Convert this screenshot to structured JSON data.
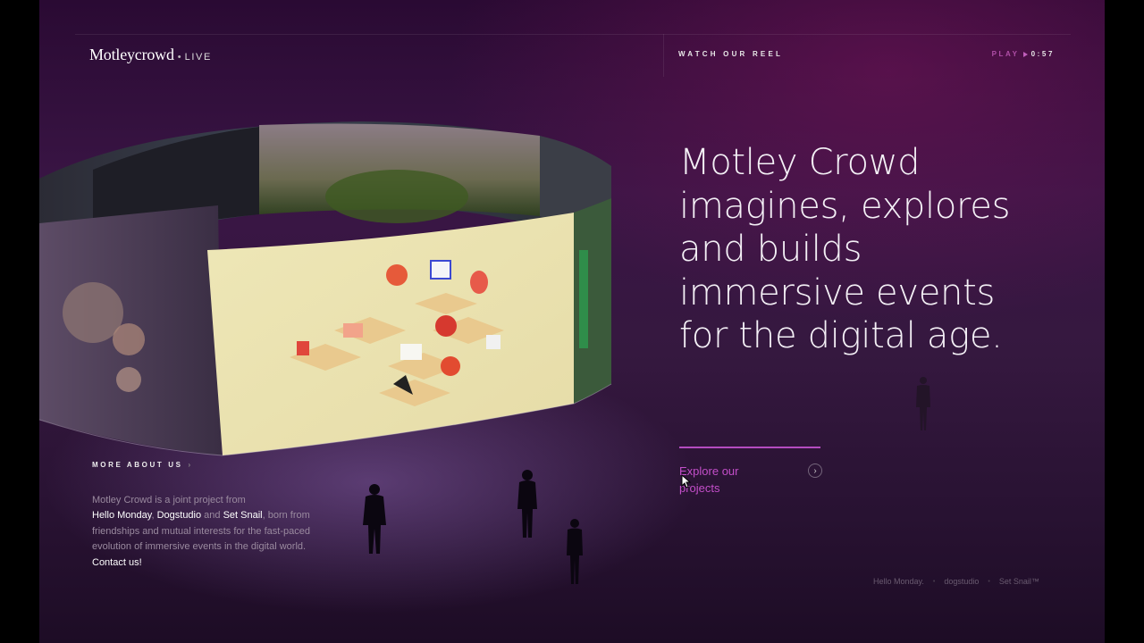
{
  "header": {
    "logo_main": "Motleycrowd",
    "logo_dot": "•",
    "logo_live": "LIVE",
    "reel_label": "WATCH OUR REEL",
    "play_label": "PLAY",
    "play_time": "0:57"
  },
  "hero": {
    "headline": "Motley Crowd imagines, explores and builds immersive events for the digital age.",
    "cta_label": "Explore our projects",
    "cta_icon": "chevron-right-icon"
  },
  "about": {
    "heading": "MORE ABOUT US",
    "chevron": "›",
    "text_1": "Motley Crowd is a joint project from",
    "link_hello_monday": "Hello Monday",
    "sep_1": ", ",
    "link_dogstudio": "Dogstudio",
    "text_2": " and ",
    "link_set_snail": "Set Snail",
    "text_3": ", born from friendships and mutual interests for the fast-paced evolution of immersive events in the digital world. ",
    "link_contact": "Contact us!"
  },
  "partners": {
    "hello_monday": "Hello Monday.",
    "dogstudio": "dogstudio",
    "set_snail": "Set Snail™",
    "separator": "•"
  },
  "colors": {
    "accent": "#c34ec9",
    "background": "#35183f",
    "text": "#f4f0f6"
  }
}
